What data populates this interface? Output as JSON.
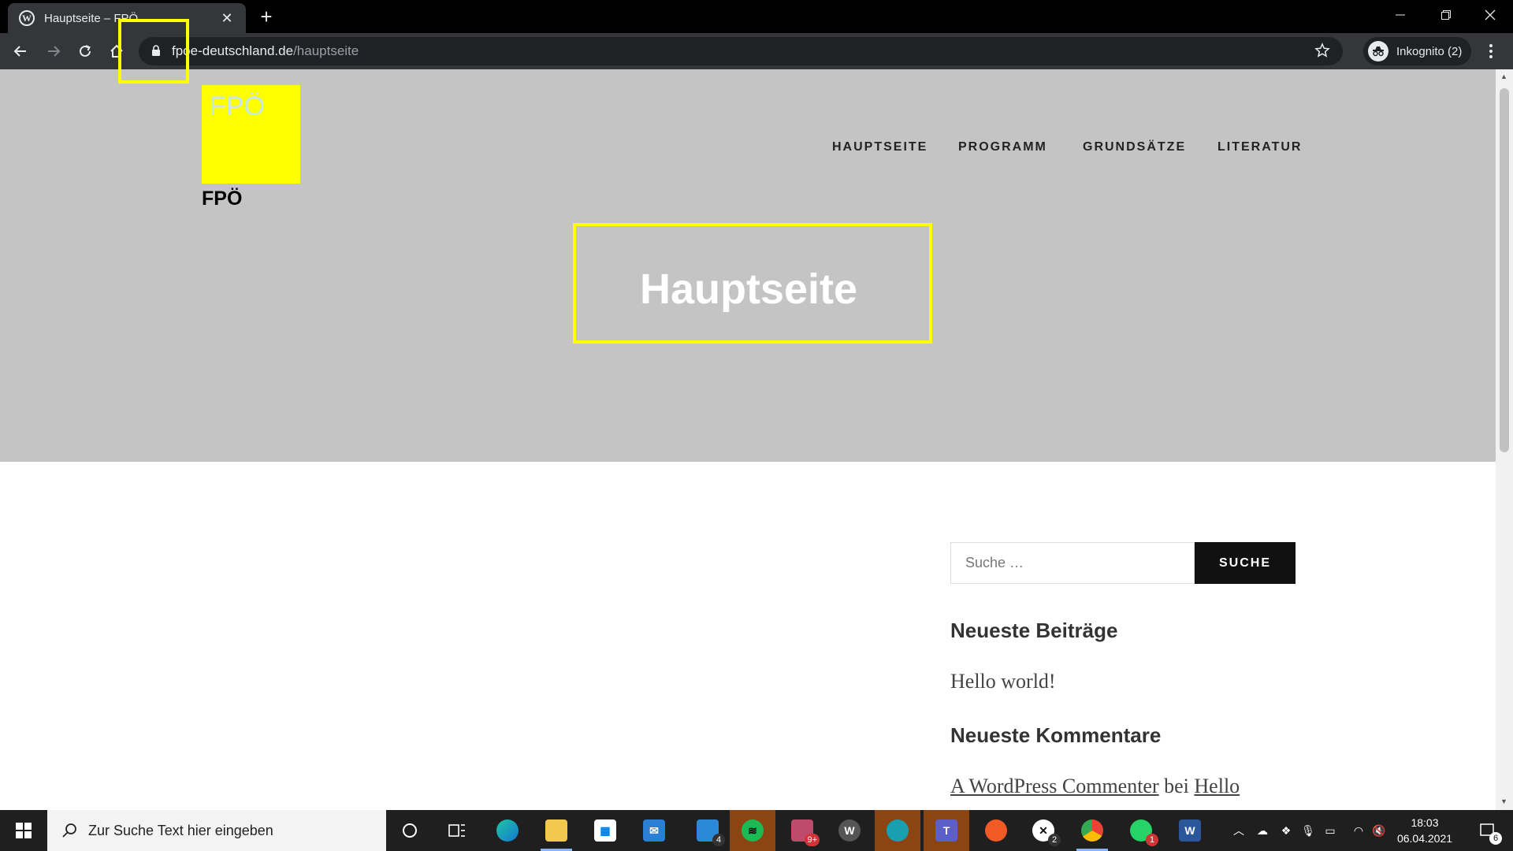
{
  "browser": {
    "tab_title": "Hauptseite – FPÖ",
    "url_host": "fpoe-deutschland.de",
    "url_path": "/hauptseite",
    "profile_label": "Inkognito (2)"
  },
  "site": {
    "logo_text": "FPÖ",
    "title": "FPÖ",
    "nav": [
      "HAUPTSEITE",
      "PROGRAMM",
      "GRUNDSÄTZE",
      "LITERATUR"
    ],
    "page_title": "Hauptseite"
  },
  "sidebar": {
    "search_placeholder": "Suche …",
    "search_button": "SUCHE",
    "recent_posts_title": "Neueste Beiträge",
    "recent_post": "Hello world!",
    "recent_comments_title": "Neueste Kommentare",
    "comment_author": "A WordPress Commenter",
    "comment_connector": "bei",
    "comment_post": "Hello"
  },
  "taskbar": {
    "search_placeholder": "Zur Suche Text hier eingeben",
    "time": "18:03",
    "date": "06.04.2021",
    "notification_count": "6",
    "badges": {
      "phone": "4",
      "photos": "9+",
      "xbox": "2",
      "whatsapp": "1"
    }
  },
  "colors": {
    "highlight": "#ffff00",
    "hero_bg": "#c4c4c4",
    "logo_bg": "#ffff00"
  }
}
